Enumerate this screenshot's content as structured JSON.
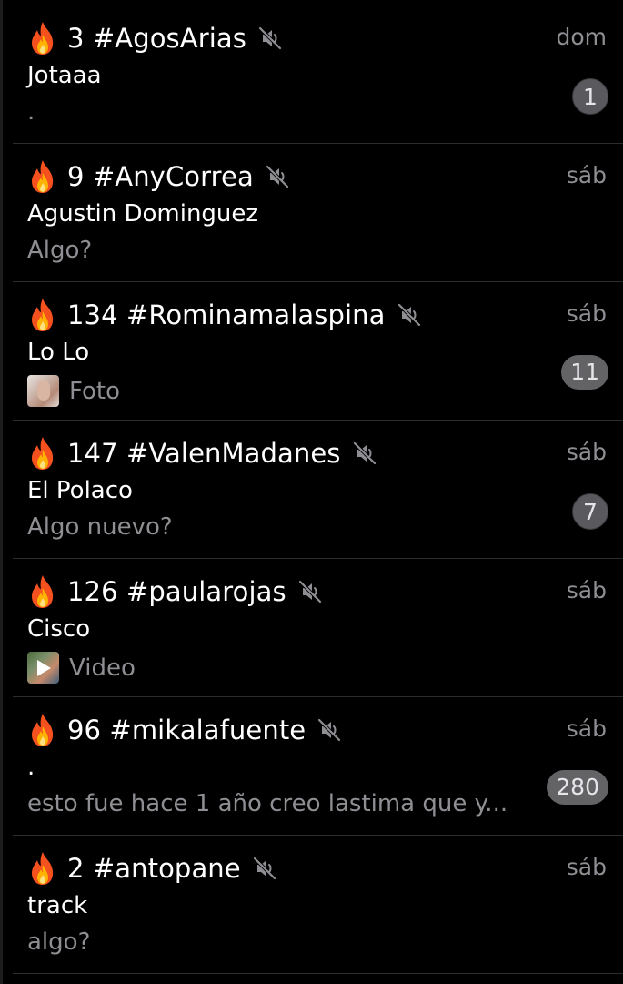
{
  "icons": {
    "fire": "fire-emoji",
    "mute": "speaker-muted-icon"
  },
  "colors": {
    "background": "#000000",
    "secondary_text": "#8e8e93",
    "badge_bg": "#636366",
    "separator": "#2c2c2e"
  },
  "chats": [
    {
      "title": "3 #AgosArias",
      "time": "dom",
      "sender": "Jotaaa",
      "preview": ".",
      "media": "",
      "badge": "1",
      "muted": true
    },
    {
      "title": "9 #AnyCorrea",
      "time": "sáb",
      "sender": "Agustin Dominguez",
      "preview": "Algo?",
      "media": "",
      "badge": "",
      "muted": true
    },
    {
      "title": "134 #Rominamalaspina",
      "time": "sáb",
      "sender": "Lo Lo",
      "preview": "Foto",
      "media": "photo",
      "badge": "11",
      "muted": true
    },
    {
      "title": "147 #ValenMadanes",
      "time": "sáb",
      "sender": "El Polaco",
      "preview": "Algo nuevo?",
      "media": "",
      "badge": "7",
      "muted": true
    },
    {
      "title": "126 #paularojas",
      "time": "sáb",
      "sender": "Cisco",
      "preview": "Video",
      "media": "video",
      "badge": "",
      "muted": true
    },
    {
      "title": "96 #mikalafuente",
      "time": "sáb",
      "sender": ".",
      "preview": "esto fue hace 1 año creo lastima que y...",
      "media": "",
      "badge": "280",
      "muted": true
    },
    {
      "title": "2 #antopane",
      "time": "sáb",
      "sender": "track",
      "preview": "algo?",
      "media": "",
      "badge": "",
      "muted": true
    }
  ]
}
